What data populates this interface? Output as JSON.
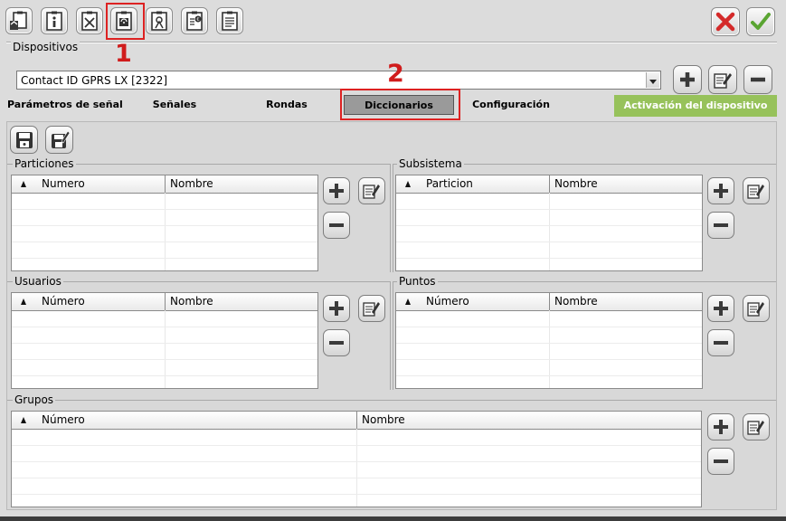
{
  "annotations": {
    "step1": "1",
    "step2": "2"
  },
  "toolbar": {
    "icons": [
      "device-home-icon",
      "device-info-icon",
      "device-x-icon",
      "device-signal-icon",
      "device-antenna-icon",
      "device-euro-icon",
      "device-list-icon"
    ]
  },
  "window_controls": {
    "cancel_icon": "red-x-icon",
    "accept_icon": "green-check-icon"
  },
  "dispositivos": {
    "label": "Dispositivos",
    "selected": "Contact ID GPRS LX [2322]"
  },
  "tabs": [
    {
      "label": "Parámetros de señal",
      "active": false
    },
    {
      "label": "Señales",
      "active": false
    },
    {
      "label": "Rondas",
      "active": false
    },
    {
      "label": "Diccionarios",
      "active": true
    },
    {
      "label": "Configuración",
      "active": false
    },
    {
      "label": "Activación del dispositivo",
      "active": false
    }
  ],
  "colors": {
    "accent_green": "#97c25b",
    "active_tab": "#9a9a9a",
    "highlight_red": "#d22222"
  },
  "sections": {
    "particiones": {
      "title": "Particiones",
      "col1": "Numero",
      "col2": "Nombre"
    },
    "subsistema": {
      "title": "Subsistema",
      "col1": "Particion",
      "col2": "Nombre"
    },
    "usuarios": {
      "title": "Usuarios",
      "col1": "Número",
      "col2": "Nombre"
    },
    "puntos": {
      "title": "Puntos",
      "col1": "Número",
      "col2": "Nombre"
    },
    "grupos": {
      "title": "Grupos",
      "col1": "Número",
      "col2": "Nombre"
    }
  }
}
